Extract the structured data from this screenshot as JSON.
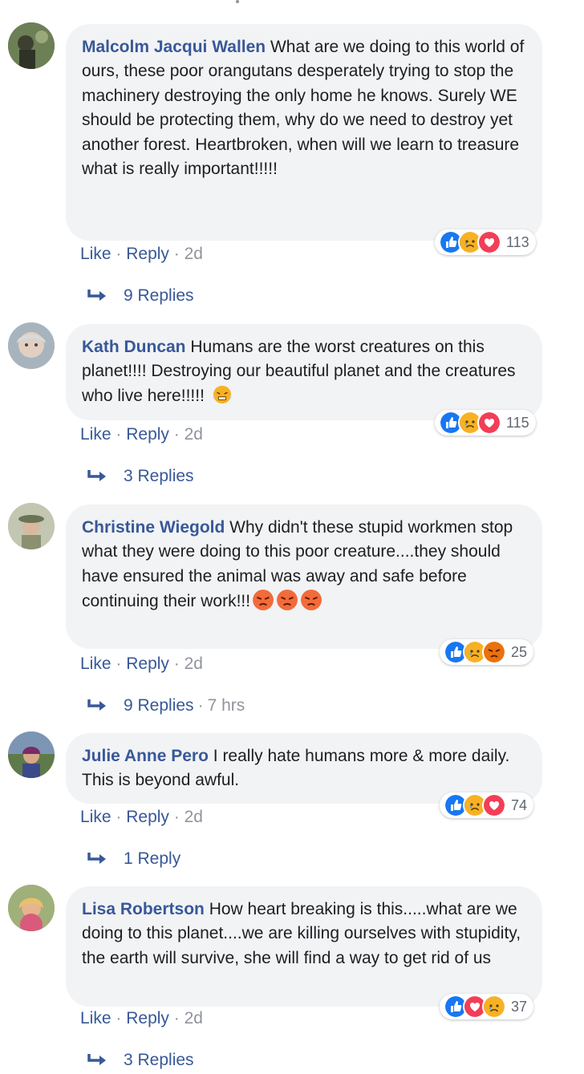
{
  "comments": [
    {
      "author": "Malcolm Jacqui Wallen",
      "text": " What are we doing to this world of ours, these poor orangutans desperately trying to stop the machinery destroying the only home he knows. Surely WE should be protecting them, why do we need to destroy yet another forest. Heartbroken, when will we learn to treasure what is really important!!!!!",
      "reactions": [
        "like-icon",
        "sad-icon",
        "love-icon"
      ],
      "reaction_count": "113",
      "like_label": "Like",
      "reply_label": "Reply",
      "time": "2d",
      "replies_label": "9 Replies",
      "replies_time": ""
    },
    {
      "author": "Kath Duncan",
      "text": " Humans are the worst creatures on this planet!!!! Destroying our beautiful planet and the creatures who live here!!!!! ",
      "emoji": [
        "steam-angry-emoji"
      ],
      "reactions": [
        "like-icon",
        "sad-icon",
        "love-icon"
      ],
      "reaction_count": "115",
      "like_label": "Like",
      "reply_label": "Reply",
      "time": "2d",
      "replies_label": "3 Replies",
      "replies_time": ""
    },
    {
      "author": "Christine Wiegold",
      "text": " Why didn't these stupid workmen stop what they were doing to this poor creature....they should have ensured the animal was away and safe before continuing their work!!!",
      "emoji": [
        "angry-emoji",
        "angry-emoji",
        "angry-emoji"
      ],
      "reactions": [
        "like-icon",
        "sad-icon",
        "angry-icon"
      ],
      "reaction_count": "25",
      "like_label": "Like",
      "reply_label": "Reply",
      "time": "2d",
      "replies_label": "9 Replies",
      "replies_time": "7 hrs"
    },
    {
      "author": "Julie Anne Pero",
      "text": " I really hate humans more & more daily. This is beyond awful.",
      "reactions": [
        "like-icon",
        "sad-icon",
        "love-icon"
      ],
      "reaction_count": "74",
      "like_label": "Like",
      "reply_label": "Reply",
      "time": "2d",
      "replies_label": "1 Reply",
      "replies_time": ""
    },
    {
      "author": "Lisa Robertson",
      "text": " How heart breaking is this.....what are we doing to this planet....we are killing ourselves with stupidity, the earth will survive, she will find a way to get rid of us",
      "reactions": [
        "like-icon",
        "love-icon",
        "sad-icon"
      ],
      "reaction_count": "37",
      "like_label": "Like",
      "reply_label": "Reply",
      "time": "2d",
      "replies_label": "3 Replies",
      "replies_time": ""
    }
  ],
  "separator": "·",
  "colors": {
    "link": "#385898",
    "muted": "#90949c",
    "bubble": "#f2f3f5",
    "like": "#1877f2",
    "love": "#f33e58",
    "sad": "#f7b125",
    "angry": "#e9710f"
  }
}
